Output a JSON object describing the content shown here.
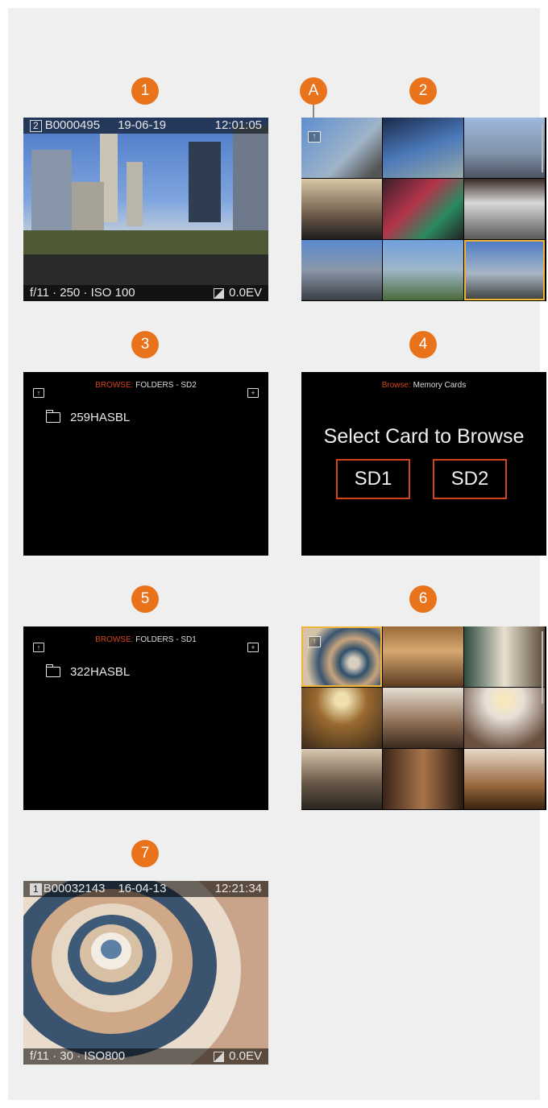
{
  "callouts": {
    "c1": "1",
    "c2": "2",
    "cA": "A",
    "c3": "3",
    "c4": "4",
    "c5": "5",
    "c6": "6",
    "c7": "7"
  },
  "screen1": {
    "card_num": "2",
    "file": "B0000495",
    "date": "19-06-19",
    "time": "12:01:05",
    "exposure": "f/11 · 250 · ISO 100",
    "ev": "0.0EV"
  },
  "screen3": {
    "browse_label": "BROWSE:",
    "location": "FOLDERS - SD2",
    "folder": "259HASBL"
  },
  "screen4": {
    "browse_label": "Browse:",
    "location": "Memory Cards",
    "title": "Select Card to Browse",
    "card1": "SD1",
    "card2": "SD2"
  },
  "screen5": {
    "browse_label": "BROWSE:",
    "location": "FOLDERS - SD1",
    "folder": "322HASBL"
  },
  "screen7": {
    "card_num": "1",
    "file": "B00032143",
    "date": "16-04-13",
    "time": "12:21:34",
    "exposure": "f/11 · 30 · ISO800",
    "ev": "0.0EV"
  },
  "icons": {
    "up_folder": "up-arrow-folder-icon",
    "new_folder": "plus-folder-icon",
    "folder": "folder-icon",
    "exposure_comp": "exposure-compensation-icon"
  },
  "colors": {
    "callout": "#e8731b",
    "accent_red": "#d4431b",
    "selection": "#f0b43a",
    "panel_bg": "#efefef"
  }
}
